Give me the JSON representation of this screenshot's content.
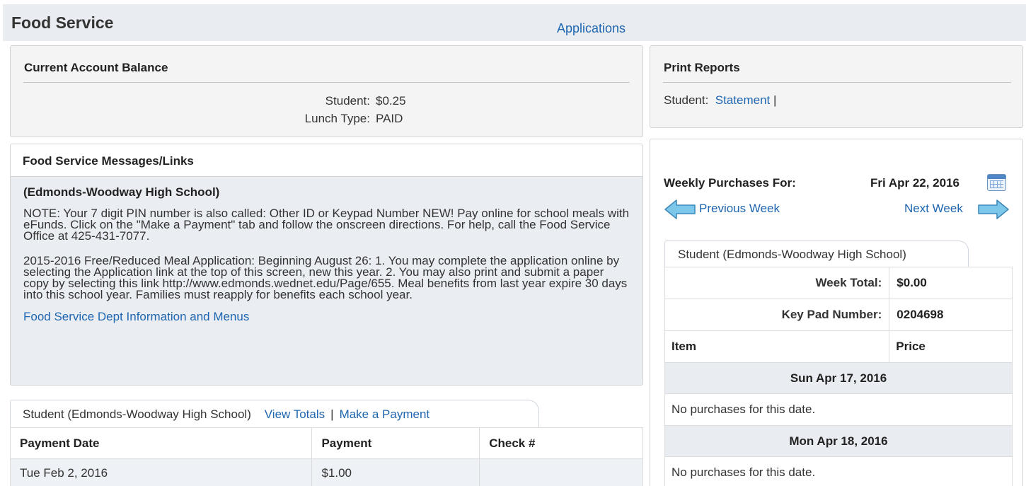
{
  "header": {
    "title": "Food Service",
    "applications_link": "Applications"
  },
  "balance": {
    "heading": "Current Account Balance",
    "student_label": "Student:",
    "student_value": "$0.25",
    "lunch_type_label": "Lunch Type:",
    "lunch_type_value": "PAID"
  },
  "reports": {
    "heading": "Print Reports",
    "student_label": "Student:",
    "statement_link": "Statement",
    "separator": "|"
  },
  "messages": {
    "heading": "Food Service Messages/Links",
    "school": "(Edmonds-Woodway High School)",
    "paragraphs": [
      "NOTE: Your 7 digit PIN number is also called: Other ID or Keypad Number NEW! Pay online for school meals with eFunds. Click on the \"Make a Payment\" tab and follow the onscreen directions. For help, call the Food Service Office at 425-431-7077.",
      "2015-2016 Free/Reduced Meal Application: Beginning August 26: 1. You may complete the application online by selecting the Application link at the top of this screen, new this year. 2. You may also print and submit a paper copy by selecting this link http://www.edmonds.wednet.edu/Page/655. Meal benefits from last year expire 30 days into this school year. Families must reapply for benefits each school year."
    ],
    "dept_link": "Food Service Dept Information and Menus"
  },
  "payments": {
    "tab_label": "Student (Edmonds-Woodway High School)",
    "view_totals": "View Totals",
    "separator": "|",
    "make_payment": "Make a Payment",
    "columns": [
      "Payment Date",
      "Payment",
      "Check #"
    ],
    "rows": [
      [
        "Tue Feb 2, 2016",
        "$1.00",
        ""
      ]
    ]
  },
  "weekly": {
    "label": "Weekly Purchases For:",
    "date": "Fri Apr 22, 2016",
    "calendar_icon": "calendar-icon",
    "prev_week": "Previous Week",
    "next_week": "Next Week",
    "tab_label": "Student (Edmonds-Woodway High School)",
    "week_total_label": "Week Total:",
    "week_total_value": "$0.00",
    "keypad_label": "Key Pad Number:",
    "keypad_value": "0204698",
    "item_header": "Item",
    "price_header": "Price",
    "days": [
      {
        "date": "Sun Apr 17, 2016",
        "note": "No purchases for this date."
      },
      {
        "date": "Mon Apr 18, 2016",
        "note": "No purchases for this date."
      }
    ]
  },
  "colors": {
    "link": "#1f66b0",
    "arrow_fill": "#7cc7ea",
    "header_bg": "#e9edf1"
  }
}
